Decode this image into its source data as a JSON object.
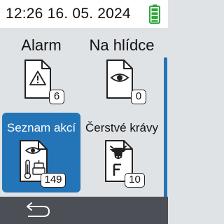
{
  "status": {
    "time": "12:26",
    "date": "16. 05. 2024",
    "battery_icon": "battery-full-icon",
    "battery_color": "#2ea83a"
  },
  "tiles": [
    {
      "label": "Alarm",
      "icon": "warning-document-icon",
      "badge": "6",
      "selected": false
    },
    {
      "label": "Na hlídce",
      "icon": "eye-document-icon",
      "badge": "0",
      "selected": false
    },
    {
      "label": "Seznam akcí",
      "icon": "action-list-icon",
      "badge": "149",
      "selected": true
    },
    {
      "label": "Čerstvé krávy",
      "icon": "fresh-cow-icon",
      "badge": "10",
      "selected": false
    }
  ],
  "bottom": {
    "back_icon": "back-arrow-icon"
  },
  "colors": {
    "accent": "#2475b8",
    "background": "#dfe3e6",
    "bottom_bar": "#4c4f55"
  }
}
